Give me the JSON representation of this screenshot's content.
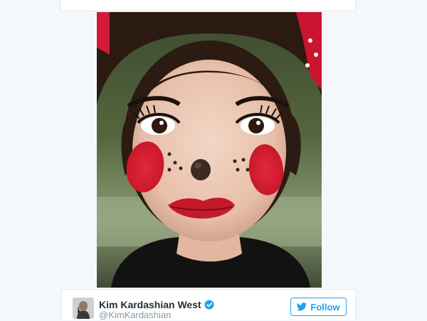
{
  "tweet": {
    "author": {
      "display_name": "Kim Kardashian West",
      "handle": "@KimKardashian",
      "verified": true
    },
    "follow_label": "Follow",
    "icons": {
      "verified": "verified-badge-icon",
      "follow": "twitter-bird-icon"
    }
  },
  "colors": {
    "accent": "#1da1f2",
    "name": "#292f33",
    "handle": "#8899a6",
    "background": "#f5f8fa"
  }
}
